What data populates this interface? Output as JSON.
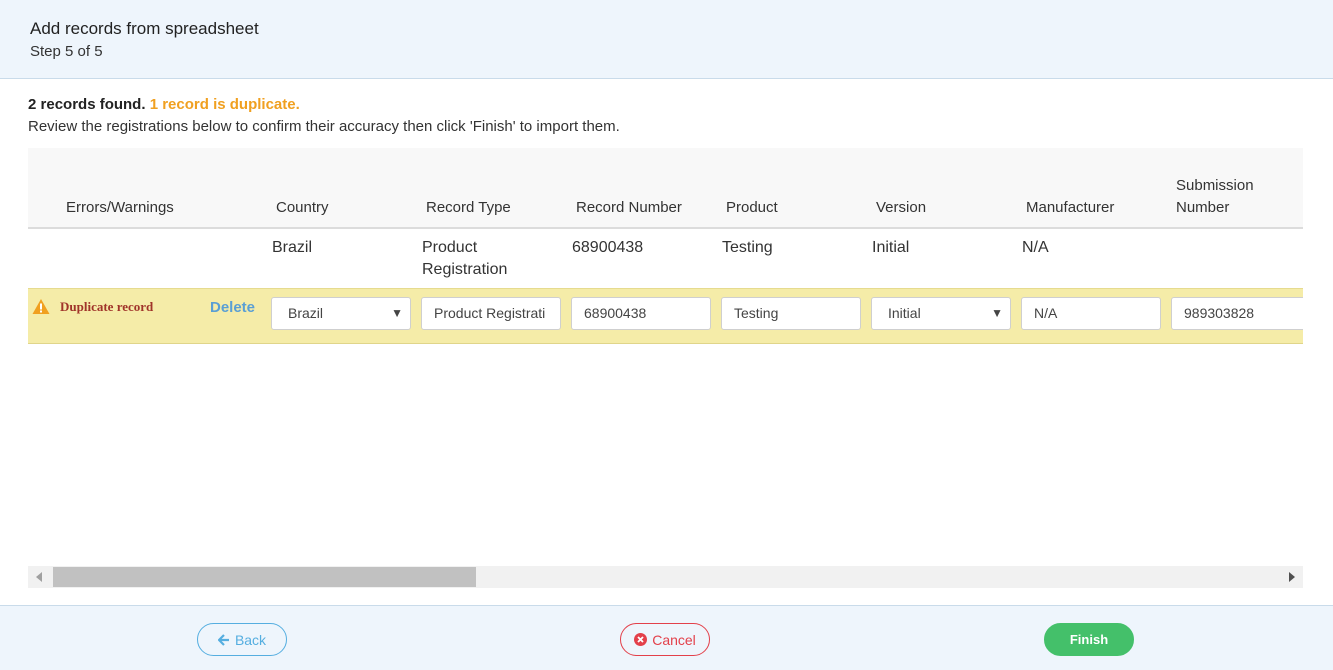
{
  "header": {
    "title": "Add records from spreadsheet",
    "step": "Step 5 of 5"
  },
  "summary": {
    "found": "2 records found.",
    "duplicate": "1 record is duplicate.",
    "instructions": "Review the registrations below to confirm their accuracy then click 'Finish' to import them."
  },
  "table": {
    "columns": {
      "errors": "Errors/Warnings",
      "country": "Country",
      "record_type": "Record Type",
      "record_number": "Record Number",
      "product": "Product",
      "version": "Version",
      "manufacturer": "Manufacturer",
      "submission_line1": "Submission",
      "submission_line2": "Number"
    },
    "existing_row": {
      "country": "Brazil",
      "record_type_line1": "Product",
      "record_type_line2": "Registration",
      "record_number": "68900438",
      "product": "Testing",
      "version": "Initial",
      "manufacturer": "N/A"
    },
    "duplicate_row": {
      "warning_label": "Duplicate record",
      "delete_label": "Delete",
      "country": "Brazil",
      "record_type": "Product Registrati",
      "record_number": "68900438",
      "product": "Testing",
      "version": "Initial",
      "manufacturer": "N/A",
      "submission_number": "989303828"
    }
  },
  "footer": {
    "back_label": "Back",
    "cancel_label": "Cancel",
    "finish_label": "Finish"
  },
  "colors": {
    "duplicate_highlight": "#f5eca8",
    "warning_text": "#a0342a",
    "summary_duplicate": "#f0a020",
    "link": "#5a9fd4",
    "back": "#55aee0",
    "cancel": "#e3404a",
    "finish": "#44c06a"
  }
}
